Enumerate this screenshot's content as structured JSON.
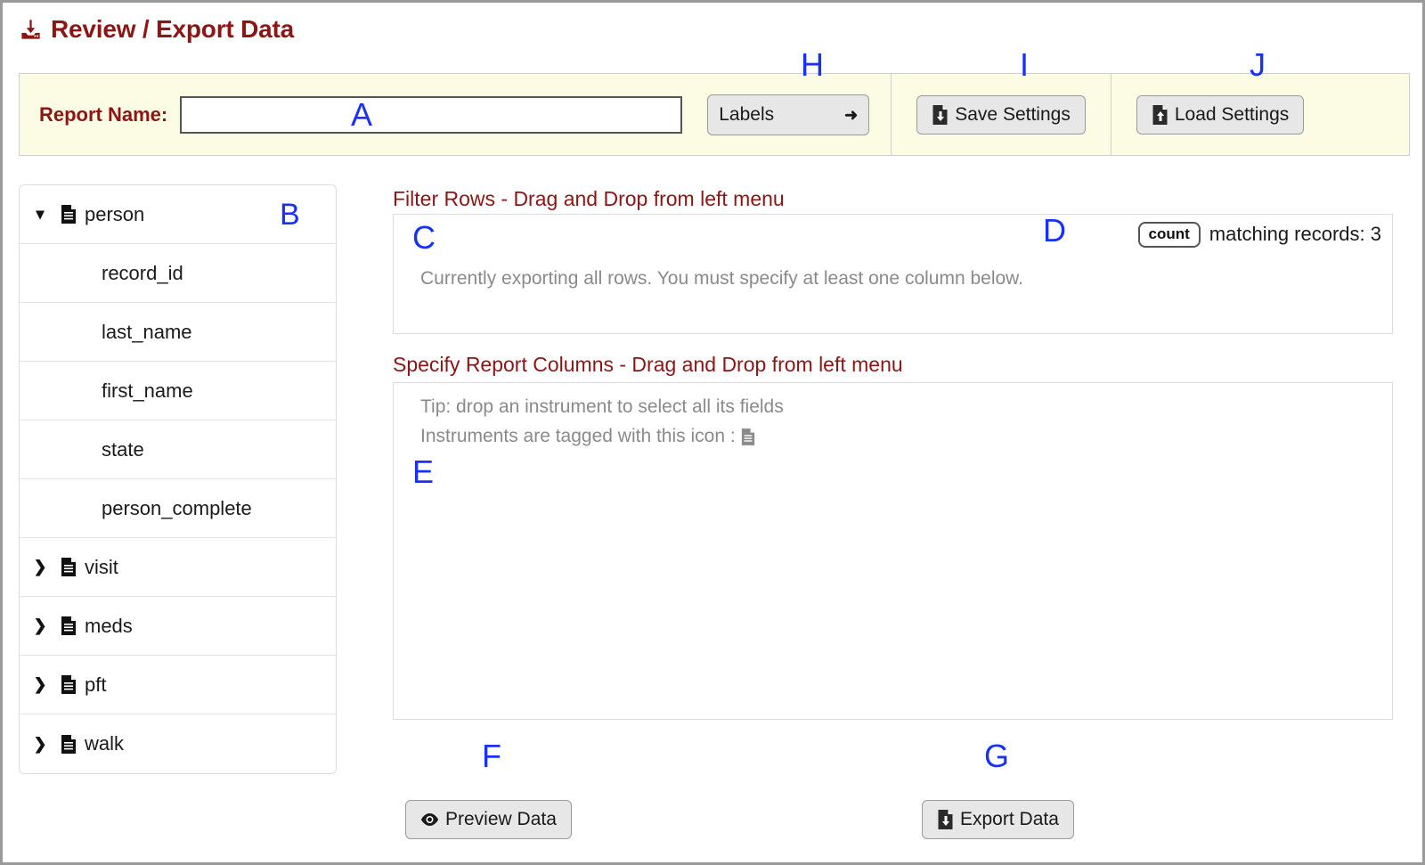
{
  "page": {
    "title": "Review / Export Data",
    "title_icon": "download-icon"
  },
  "settings_bar": {
    "report_name_label": "Report Name:",
    "report_name_value": "",
    "report_name_placeholder": "",
    "labels_select_value": "Labels",
    "labels_select_options": [
      "Labels"
    ],
    "save_settings_label": "Save Settings",
    "load_settings_label": "Load Settings",
    "save_icon": "file-download-icon",
    "load_icon": "file-upload-icon"
  },
  "callouts": {
    "a": "A",
    "b": "B",
    "c": "C",
    "d": "D",
    "e": "E",
    "f": "F",
    "g": "G",
    "h": "H",
    "i": "I",
    "j": "J"
  },
  "tree": {
    "rows": [
      {
        "label": "person",
        "type": "instrument",
        "expanded": true,
        "arrow": "chevron-down-icon"
      },
      {
        "label": "record_id",
        "type": "field"
      },
      {
        "label": "last_name",
        "type": "field"
      },
      {
        "label": "first_name",
        "type": "field"
      },
      {
        "label": "state",
        "type": "field"
      },
      {
        "label": "person_complete",
        "type": "field"
      },
      {
        "label": "visit",
        "type": "instrument",
        "expanded": false,
        "arrow": "chevron-right-icon"
      },
      {
        "label": "meds",
        "type": "instrument",
        "expanded": false,
        "arrow": "chevron-right-icon"
      },
      {
        "label": "pft",
        "type": "instrument",
        "expanded": false,
        "arrow": "chevron-right-icon"
      },
      {
        "label": "walk",
        "type": "instrument",
        "expanded": false,
        "arrow": "chevron-right-icon"
      }
    ]
  },
  "filter_section": {
    "heading": "Filter Rows - Drag and Drop from left menu",
    "hint": "Currently exporting all rows. You must specify at least one column below.",
    "count_button_label": "count",
    "matching_records_text": "matching records: 3"
  },
  "columns_section": {
    "heading": "Specify Report Columns - Drag and Drop from left menu",
    "hint_line1": "Tip: drop an instrument to select all its fields",
    "hint_line2": "Instruments are tagged with this icon :",
    "hint_icon": "file-lines-icon"
  },
  "footer": {
    "preview_label": "Preview Data",
    "preview_icon": "eye-icon",
    "export_label": "Export Data",
    "export_icon": "file-download-icon"
  },
  "colors": {
    "brand_red": "#8C1515",
    "callout_blue": "#1831f5",
    "settings_bar_bg": "#fcfce4",
    "button_bg": "#e7e7e7",
    "hint_gray": "#8a8a8a"
  }
}
